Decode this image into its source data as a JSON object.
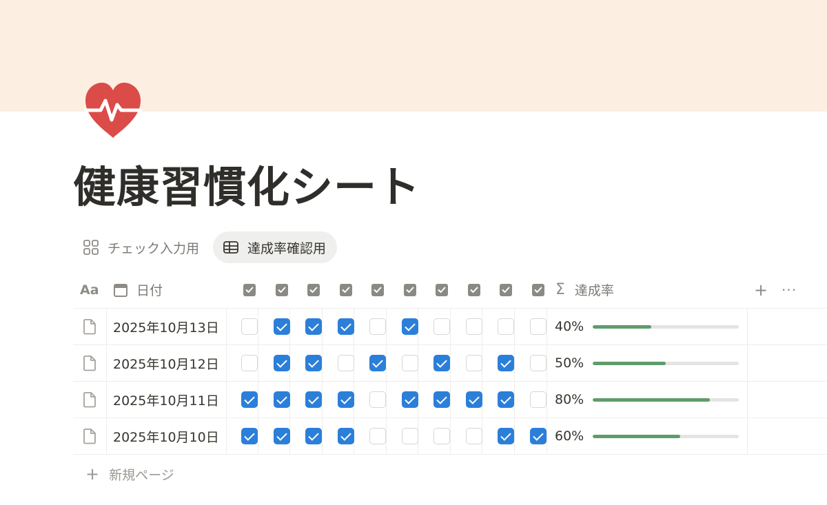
{
  "page": {
    "title": "健康習慣化シート",
    "icon": "heart-pulse-icon",
    "cover_color": "#fdeee2"
  },
  "tabs": [
    {
      "label": "チェック入力用",
      "icon": "gallery-icon",
      "active": false
    },
    {
      "label": "達成率確認用",
      "icon": "table-icon",
      "active": true
    }
  ],
  "table": {
    "headers": {
      "title_icon_text": "Aa",
      "date_label": "日付",
      "rate_label": "達成率",
      "sigma": "Σ",
      "add": "+",
      "more": "···"
    },
    "rows": [
      {
        "date": "2025年10月13日",
        "checks": [
          false,
          true,
          true,
          true,
          false,
          true,
          false,
          false,
          false,
          false
        ],
        "rate_text": "40%",
        "rate": 0.4
      },
      {
        "date": "2025年10月12日",
        "checks": [
          false,
          true,
          true,
          false,
          true,
          false,
          true,
          false,
          true,
          false
        ],
        "rate_text": "50%",
        "rate": 0.5
      },
      {
        "date": "2025年10月11日",
        "checks": [
          true,
          true,
          true,
          true,
          false,
          true,
          true,
          true,
          true,
          false
        ],
        "rate_text": "80%",
        "rate": 0.8
      },
      {
        "date": "2025年10月10日",
        "checks": [
          true,
          true,
          true,
          true,
          false,
          false,
          false,
          false,
          true,
          true
        ],
        "rate_text": "60%",
        "rate": 0.6
      }
    ],
    "new_page_label": "新規ページ",
    "colors": {
      "checked": "#2b7fd9",
      "progress": "#5e9c6b"
    }
  }
}
